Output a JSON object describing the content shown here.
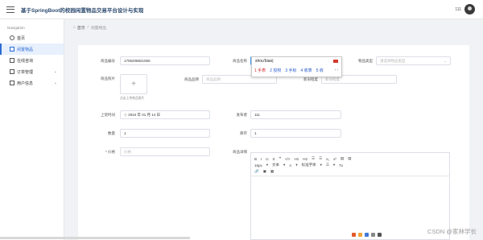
{
  "app": {
    "title": "基于SpringBoot的校园闲置物品交易平台设计与实现",
    "user_label": "111"
  },
  "sidebar": {
    "heading": "Navigation",
    "items": [
      {
        "label": "首页",
        "icon": "home-icon"
      },
      {
        "label": "闲置物品",
        "icon": "goods-icon"
      },
      {
        "label": "在线咨询",
        "icon": "chat-icon"
      },
      {
        "label": "订单管理",
        "icon": "order-icon"
      },
      {
        "label": "用户信息",
        "icon": "user-icon"
      }
    ]
  },
  "breadcrumb": {
    "home": "首页",
    "current": "闲置物品"
  },
  "form": {
    "code_label": "商品编号",
    "code_value": "1706208821050",
    "name_label": "商品名称",
    "name_value": "shoubiao",
    "type_label": "物品类型",
    "type_placeholder": "请选择物品类型",
    "image_label": "商品照片",
    "upload_tip": "点击上传商品照片",
    "brand_label": "商品品牌",
    "brand_placeholder": "商品品牌",
    "new_label": "新旧程度",
    "new_placeholder": "新旧程度",
    "time_label": "上架时间",
    "time_value": "2024 年 01 月 14 日",
    "account_label": "发布者",
    "account_value": "111",
    "count_label": "数量",
    "count_value": "1",
    "stock_label": "库存",
    "stock_value": "1",
    "price_label": "* 价格",
    "price_placeholder": "价格",
    "detail_label": "商品详情"
  },
  "ime": {
    "code": "shou'biao|",
    "candidates": [
      "1 手表",
      "2 授权",
      "3 手标",
      "4 收表",
      "5 收"
    ]
  },
  "editor_toolbar": {
    "row1": [
      "B",
      "I",
      "U",
      "S",
      "❝",
      "</>",
      "H1",
      "H2",
      "☰",
      "☰",
      "x₂",
      "x²",
      "▤",
      "▤"
    ],
    "row2": [
      "16px",
      "▾",
      "文本",
      "▾",
      "A",
      "▾",
      "标准字体",
      "▾",
      "☰",
      "▾",
      "Tx"
    ],
    "row3": [
      "🔗",
      "▣",
      "▦"
    ]
  },
  "watermark": "CSDN @家林学长"
}
